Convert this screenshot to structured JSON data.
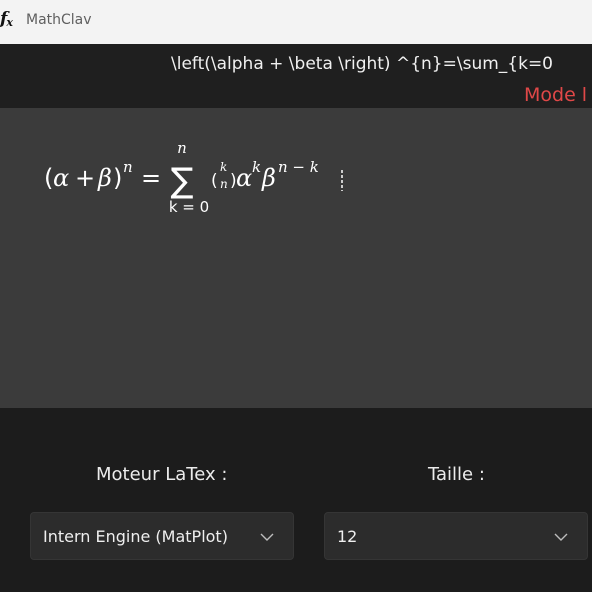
{
  "app": {
    "title": "MathClav",
    "icon": "fx-icon",
    "icon_text": "f",
    "icon_sub": "x"
  },
  "editor": {
    "latex_source": "\\left(\\alpha + \\beta  \\right) ^{n}=\\sum_{k=0",
    "mode_label": "Mode l"
  },
  "preview": {
    "formula": {
      "open_paren": "(",
      "alpha": "α",
      "plus": "+",
      "beta": "β",
      "close_paren": ")",
      "exp_n": "n",
      "equals": "=",
      "sum_upper": "n",
      "sum_symbol": "∑",
      "sum_lower": "k = 0",
      "binom_open": "(",
      "binom_top": "k",
      "binom_bottom": "n",
      "binom_close": ")",
      "alpha2": "α",
      "exp_k": "k",
      "beta2": "β",
      "exp_nk": "n − k"
    }
  },
  "settings": {
    "engine_label": "Moteur LaTex :",
    "engine_value": "Intern Engine (MatPlot)",
    "size_label": "Taille :",
    "size_value": "12"
  },
  "colors": {
    "titlebar_bg": "#f3f3f3",
    "editor_bg": "#1f1f1f",
    "preview_bg": "#3b3b3b",
    "mode_label": "#e04848"
  }
}
